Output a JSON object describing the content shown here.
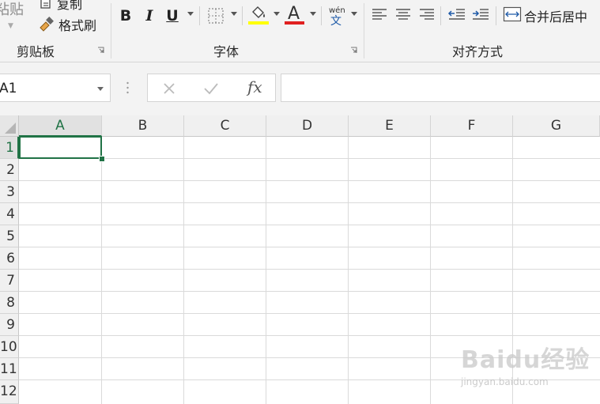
{
  "ribbon": {
    "clipboard": {
      "paste_label": "粘贴",
      "copy_label": "复制",
      "format_painter_label": "格式刷",
      "group_label": "剪贴板"
    },
    "font": {
      "bold": "B",
      "italic": "I",
      "underline": "U",
      "font_color_letter": "A",
      "highlight_color": "#ffff00",
      "font_color": "#e02020",
      "phonetic_top": "wén",
      "phonetic_bottom": "文",
      "group_label": "字体"
    },
    "alignment": {
      "merge_center_label": "合并后居中",
      "group_label": "对齐方式"
    }
  },
  "formula_bar": {
    "name_box": "A1",
    "fx_label": "fx",
    "formula": ""
  },
  "sheet": {
    "columns": [
      "A",
      "B",
      "C",
      "D",
      "E",
      "F",
      "G"
    ],
    "rows": [
      "1",
      "2",
      "3",
      "4",
      "5",
      "6",
      "7",
      "8",
      "9",
      "10",
      "11",
      "12"
    ],
    "active_cell": "A1",
    "accent_color": "#217346"
  },
  "watermark": {
    "brand": "Baidu经验",
    "url": "jingyan.baidu.com"
  }
}
